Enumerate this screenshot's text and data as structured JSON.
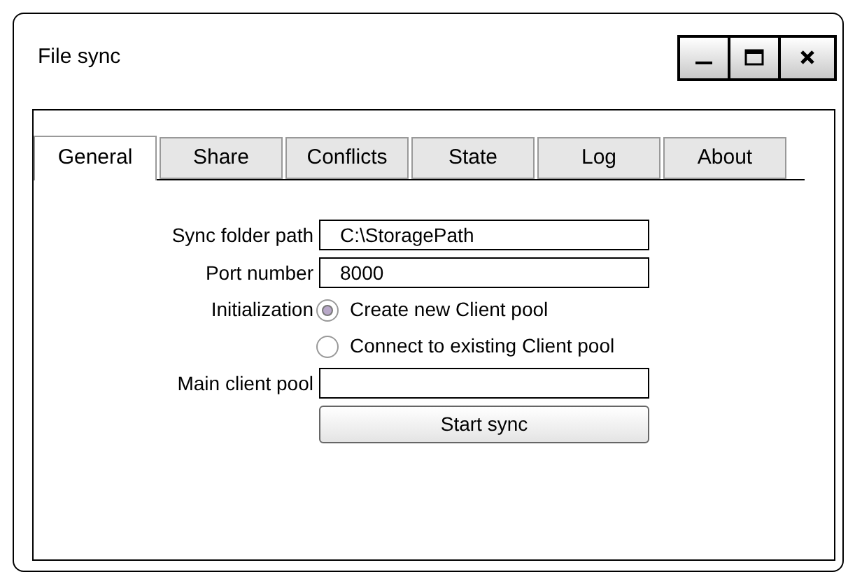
{
  "window": {
    "title": "File sync"
  },
  "tabs": [
    {
      "label": "General",
      "selected": true
    },
    {
      "label": "Share",
      "selected": false
    },
    {
      "label": "Conflicts",
      "selected": false
    },
    {
      "label": "State",
      "selected": false
    },
    {
      "label": "Log",
      "selected": false
    },
    {
      "label": "About",
      "selected": false
    }
  ],
  "form": {
    "sync_folder_path": {
      "label": "Sync folder path",
      "value": "C:\\StoragePath"
    },
    "port_number": {
      "label": "Port number",
      "value": "8000"
    },
    "initialization": {
      "label": "Initialization",
      "options": [
        {
          "label": "Create new Client pool",
          "selected": true
        },
        {
          "label": "Connect to existing Client pool",
          "selected": false
        }
      ]
    },
    "main_client_pool": {
      "label": "Main client pool"
    },
    "start_button": "Start sync"
  }
}
